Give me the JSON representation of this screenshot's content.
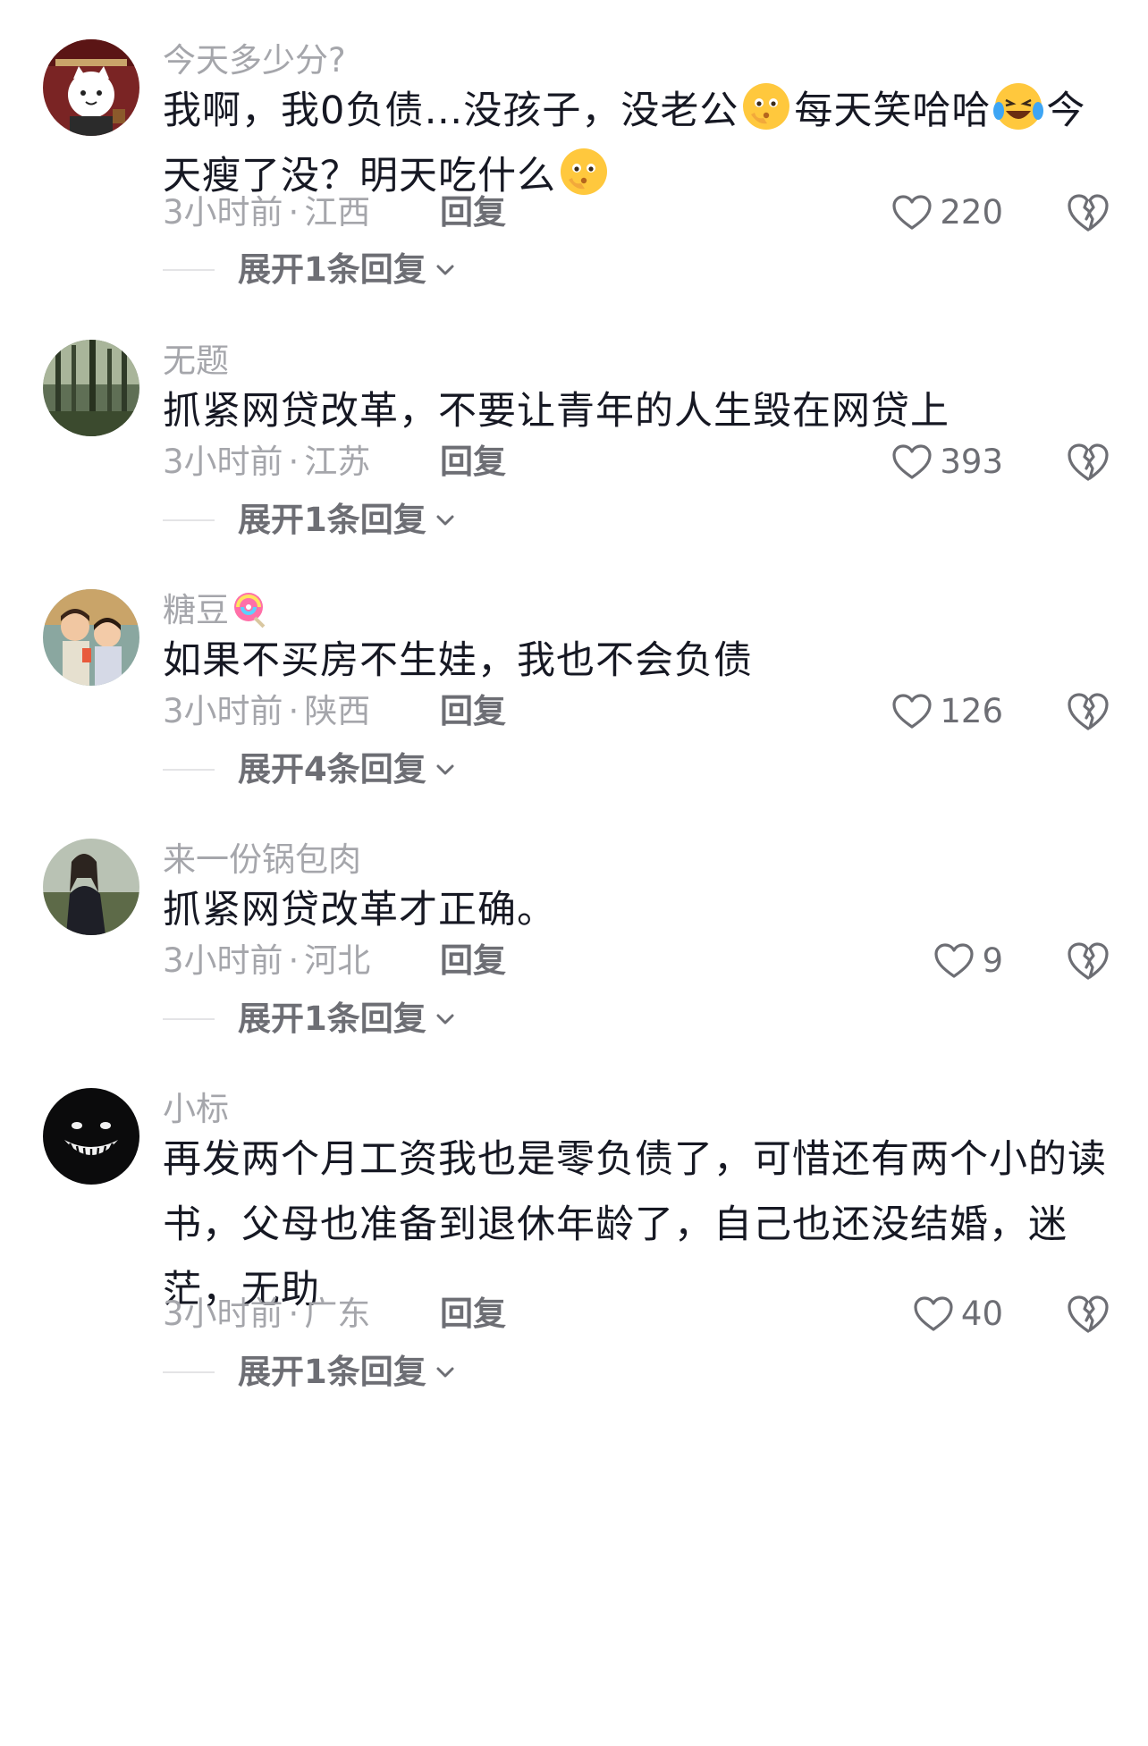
{
  "comments": [
    {
      "username": "今天多少分?",
      "avatar": "cat-avatar",
      "content_segments": [
        {
          "type": "text",
          "value": "我啊，我0负债…没孩子，没老公"
        },
        {
          "type": "emoji",
          "name": "thinking-face-emoji"
        },
        {
          "type": "text",
          "value": "每天笑哈哈"
        },
        {
          "type": "emoji",
          "name": "laughing-crying-emoji"
        },
        {
          "type": "text",
          "value": "今天瘦了没？明天吃什么"
        },
        {
          "type": "emoji",
          "name": "thinking-face-emoji"
        }
      ],
      "time": "3小时前",
      "separator": "·",
      "location": "江西",
      "reply_label": "回复",
      "likes": "220",
      "expand_label": "展开1条回复"
    },
    {
      "username": "无题",
      "avatar": "forest-avatar",
      "content": "抓紧网贷改革，不要让青年的人生毁在网贷上",
      "time": "3小时前",
      "separator": "·",
      "location": "江苏",
      "reply_label": "回复",
      "likes": "393",
      "expand_label": "展开1条回复"
    },
    {
      "username": "糖豆",
      "username_emoji": "lollipop-emoji",
      "avatar": "couple-avatar",
      "content": "如果不买房不生娃，我也不会负债",
      "time": "3小时前",
      "separator": "·",
      "location": "陕西",
      "reply_label": "回复",
      "likes": "126",
      "expand_label": "展开4条回复"
    },
    {
      "username": "来一份锅包肉",
      "avatar": "person-avatar",
      "content": "抓紧网贷改革才正确。",
      "time": "3小时前",
      "separator": "·",
      "location": "河北",
      "reply_label": "回复",
      "likes": "9",
      "expand_label": "展开1条回复"
    },
    {
      "username": "小标",
      "avatar": "grin-face-avatar",
      "content": "再发两个月工资我也是零负债了，可惜还有两个小的读书，父母也准备到退休年龄了，自己也还没结婚，迷茫，无助",
      "time": "3小时前",
      "separator": "·",
      "location": "广东",
      "reply_label": "回复",
      "likes": "40",
      "expand_label": "展开1条回复"
    }
  ],
  "icons": {
    "like": "heart-outline-icon",
    "dislike": "broken-heart-icon",
    "expand": "chevron-down-icon"
  },
  "colors": {
    "text_primary": "#161823",
    "text_secondary": "#a5a6ab",
    "text_action": "#6d6e74",
    "divider": "#e4e4e6"
  }
}
